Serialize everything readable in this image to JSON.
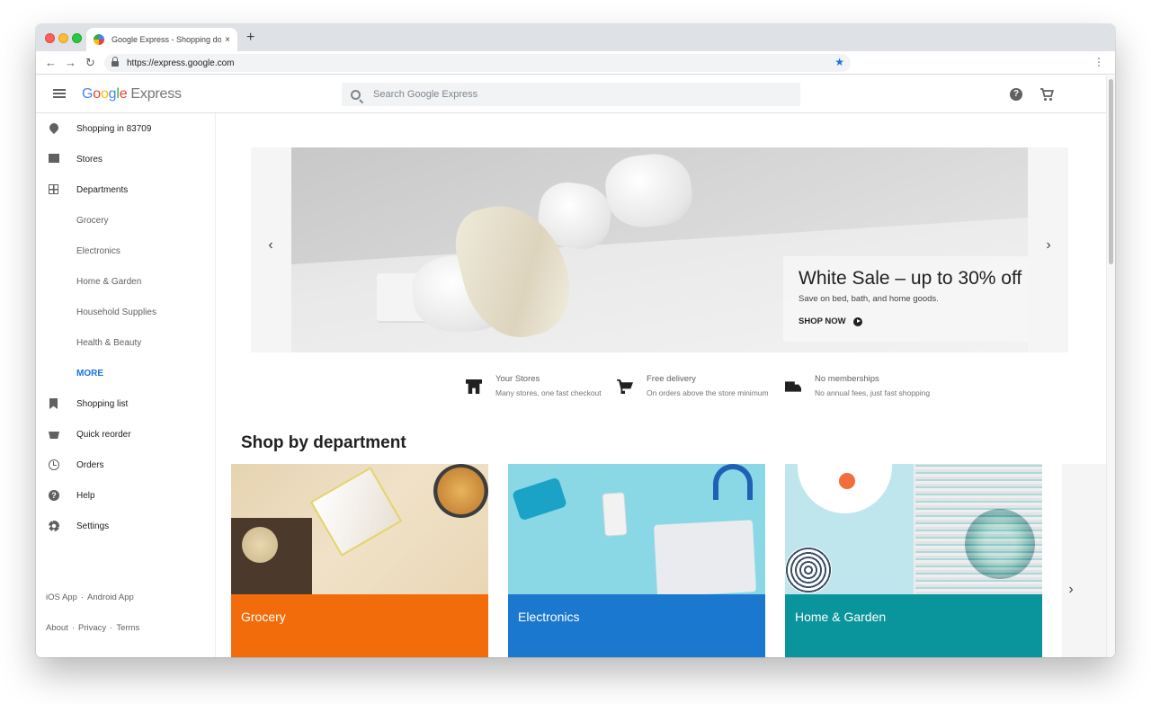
{
  "browser": {
    "tab_title": "Google Express - Shopping do",
    "tab_close": "×",
    "new_tab": "+",
    "back": "←",
    "forward": "→",
    "reload": "↻",
    "url": "https://express.google.com",
    "star": "★",
    "menu": "⋮"
  },
  "header": {
    "logo_letters": [
      "G",
      "o",
      "o",
      "g",
      "l",
      "e"
    ],
    "logo_suffix": "Express",
    "search_placeholder": "Search Google Express",
    "help_glyph": "?"
  },
  "sidebar": {
    "items": [
      {
        "label": "Shopping in 83709",
        "icon": "location-pin-icon"
      },
      {
        "label": "Stores",
        "icon": "store-icon"
      },
      {
        "label": "Departments",
        "icon": "grid-icon"
      },
      {
        "label": "Grocery",
        "icon": ""
      },
      {
        "label": "Electronics",
        "icon": ""
      },
      {
        "label": "Home & Garden",
        "icon": ""
      },
      {
        "label": "Household Supplies",
        "icon": ""
      },
      {
        "label": "Health & Beauty",
        "icon": ""
      },
      {
        "label": "MORE",
        "icon": ""
      },
      {
        "label": "Shopping list",
        "icon": "bookmark-icon"
      },
      {
        "label": "Quick reorder",
        "icon": "basket-icon"
      },
      {
        "label": "Orders",
        "icon": "history-icon"
      },
      {
        "label": "Help",
        "icon": "help-icon"
      },
      {
        "label": "Settings",
        "icon": "gear-icon"
      }
    ],
    "help_glyph": "?",
    "footer_apps": [
      "iOS App",
      "Android App"
    ],
    "footer_links": [
      "About",
      "Privacy",
      "Terms"
    ],
    "separator": "·"
  },
  "hero": {
    "prev": "‹",
    "next": "›",
    "title": "White Sale – up to 30% off",
    "subtitle": "Save on bed, bath, and home goods.",
    "cta": "SHOP NOW"
  },
  "features": [
    {
      "title": "Your Stores",
      "subtitle": "Many stores, one fast checkout",
      "icon": "store-icon"
    },
    {
      "title": "Free delivery",
      "subtitle": "On orders above the store minimum",
      "icon": "cart-icon"
    },
    {
      "title": "No memberships",
      "subtitle": "No annual fees, just fast shopping",
      "icon": "truck-icon"
    }
  ],
  "departments": {
    "heading": "Shop by department",
    "next": "›",
    "cards": [
      {
        "label": "Grocery",
        "color": "#f36c0c"
      },
      {
        "label": "Electronics",
        "color": "#1a78cf"
      },
      {
        "label": "Home & Garden",
        "color": "#0a949b"
      }
    ]
  },
  "colors": {
    "accent": "#1a73e8",
    "tab_strip": "#dee1e6"
  }
}
